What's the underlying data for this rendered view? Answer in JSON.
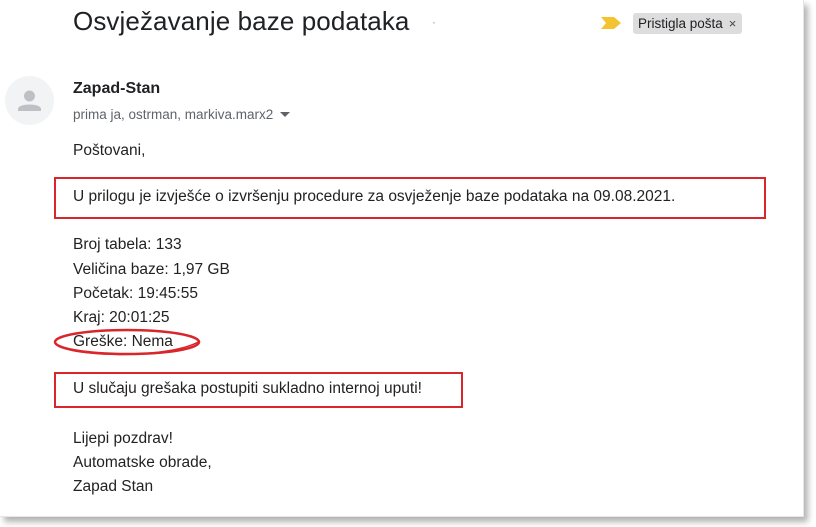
{
  "header": {
    "subject": "Osvježavanje baze podataka",
    "label": "Pristigla pošta",
    "label_close": "×"
  },
  "sender": {
    "name": "Zapad-Stan",
    "recipients": "prima ja, ostrman, markiva.marx2"
  },
  "body": {
    "greeting": "Poštovani,",
    "intro": "U prilogu je izvješće o izvršenju procedure za osvježenje baze podataka na 09.08.2021.",
    "stats": [
      "Broj tabela: 133",
      "Veličina baze: 1,97 GB",
      "Početak: 19:45:55",
      "Kraj: 20:01:25",
      "Greške: Nema"
    ],
    "instruction": "U slučaju grešaka postupiti sukladno internoj uputi!",
    "closing": [
      "Lijepi pozdrav!",
      "Automatske obrade,",
      "Zapad Stan"
    ]
  },
  "colors": {
    "highlight": "#d9262b",
    "importance": "#f4c430"
  },
  "icons": {
    "importance": "importance-marker-icon",
    "avatar": "person-icon",
    "close": "close-icon",
    "dropdown": "chevron-down-icon"
  }
}
